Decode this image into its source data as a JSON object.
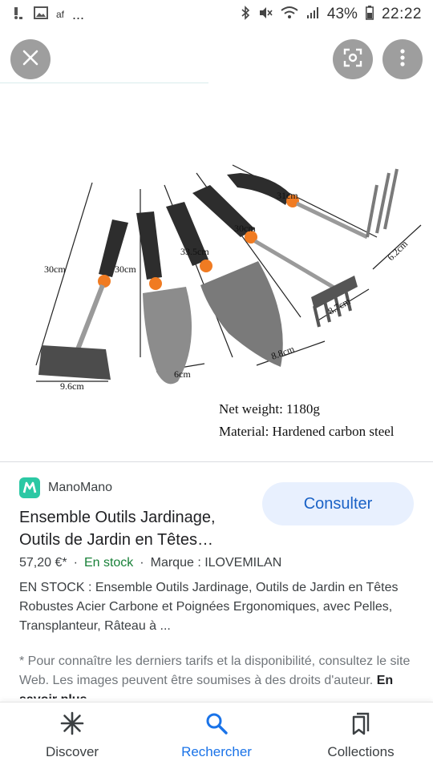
{
  "status_bar": {
    "left_text": "af",
    "dots": "...",
    "battery_percent": "43%",
    "time": "22:22"
  },
  "viewer": {
    "close_icon": "close-icon",
    "lens_icon": "google-lens-icon",
    "more_icon": "more-vert-icon",
    "image_labels": {
      "dim_1": "30cm",
      "dim_2": "30cm",
      "dim_3": "33.5cm",
      "dim_4": "30cm",
      "dim_5": "31cm",
      "dim_6": "9.6cm",
      "dim_7": "6cm",
      "dim_8": "8.8cm",
      "dim_9": "8.7cm",
      "dim_10": "6.2cm",
      "net_weight": "Net weight: 1180g",
      "material": "Material: Hardened carbon steel"
    }
  },
  "result": {
    "source": "ManoMano",
    "button": "Consulter",
    "title": "Ensemble Outils Jardinage, Outils de Jardin en Têtes…",
    "price": "57,20 €*",
    "sep1": "·",
    "stock": "En stock",
    "sep2": "·",
    "brand": "Marque : ILOVEMILAN",
    "description": "EN STOCK : Ensemble Outils Jardinage, Outils de Jardin en Têtes Robustes Acier Carbone et Poignées Ergonomiques, avec Pelles, Transplanteur, Râteau à ...",
    "disclaimer": "* Pour connaître les derniers tarifs et la disponibilité, consultez le site Web. Les images peuvent être soumises à des droits d'auteur.",
    "learn_more": "En savoir plus"
  },
  "bottom_nav": {
    "items": [
      {
        "label": "Discover",
        "icon": "asterisk-icon"
      },
      {
        "label": "Rechercher",
        "icon": "search-icon"
      },
      {
        "label": "Collections",
        "icon": "bookmarks-icon"
      }
    ],
    "active": "Rechercher"
  },
  "colors": {
    "accent": "#1a73e8",
    "button_bg": "#e8f0fe",
    "stock_green": "#188038",
    "brand_teal": "#2bc8a4"
  }
}
